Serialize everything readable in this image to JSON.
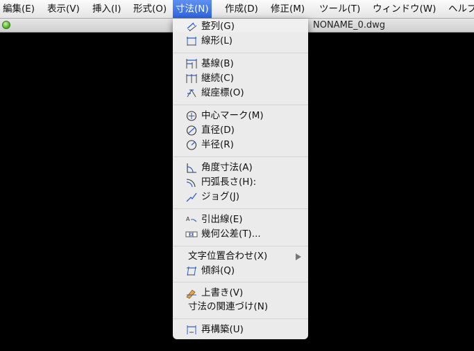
{
  "menubar": {
    "items": [
      {
        "label": "編集(E)"
      },
      {
        "label": "表示(V)"
      },
      {
        "label": "挿入(I)"
      },
      {
        "label": "形式(O)"
      },
      {
        "label": "寸法(N)"
      },
      {
        "label": "作成(D)"
      },
      {
        "label": "修正(M)"
      },
      {
        "label": "ツール(T)"
      },
      {
        "label": "ウィンドウ(W)"
      },
      {
        "label": "ヘルプ"
      }
    ]
  },
  "document": {
    "title": "NONAME_0.dwg"
  },
  "dimension_menu": {
    "items": [
      {
        "label": "整列(G)",
        "icon": "aligned-dimension-icon"
      },
      {
        "label": "線形(L)",
        "icon": "linear-dimension-icon"
      },
      {
        "label": "基線(B)",
        "icon": "baseline-dimension-icon"
      },
      {
        "label": "継続(C)",
        "icon": "continue-dimension-icon"
      },
      {
        "label": "縦座標(O)",
        "icon": "ordinate-dimension-icon"
      },
      {
        "label": "中心マーク(M)",
        "icon": "center-mark-icon"
      },
      {
        "label": "直径(D)",
        "icon": "diameter-icon"
      },
      {
        "label": "半径(R)",
        "icon": "radius-icon"
      },
      {
        "label": "角度寸法(A)",
        "icon": "angular-dimension-icon"
      },
      {
        "label": "円弧長さ(H):",
        "icon": "arc-length-icon"
      },
      {
        "label": "ジョグ(J)",
        "icon": "jogged-dimension-icon"
      },
      {
        "label": "引出線(E)",
        "icon": "leader-icon"
      },
      {
        "label": "幾何公差(T)...",
        "icon": "tolerance-icon"
      },
      {
        "label": "文字位置合わせ(X)",
        "icon": "submenu-arrow-icon"
      },
      {
        "label": "傾斜(Q)",
        "icon": "oblique-icon"
      },
      {
        "label": "上書き(V)",
        "icon": "override-icon"
      },
      {
        "label": "寸法の関連づけ(N)"
      },
      {
        "label": "再構築(U)",
        "icon": "regenerate-icon"
      }
    ]
  }
}
